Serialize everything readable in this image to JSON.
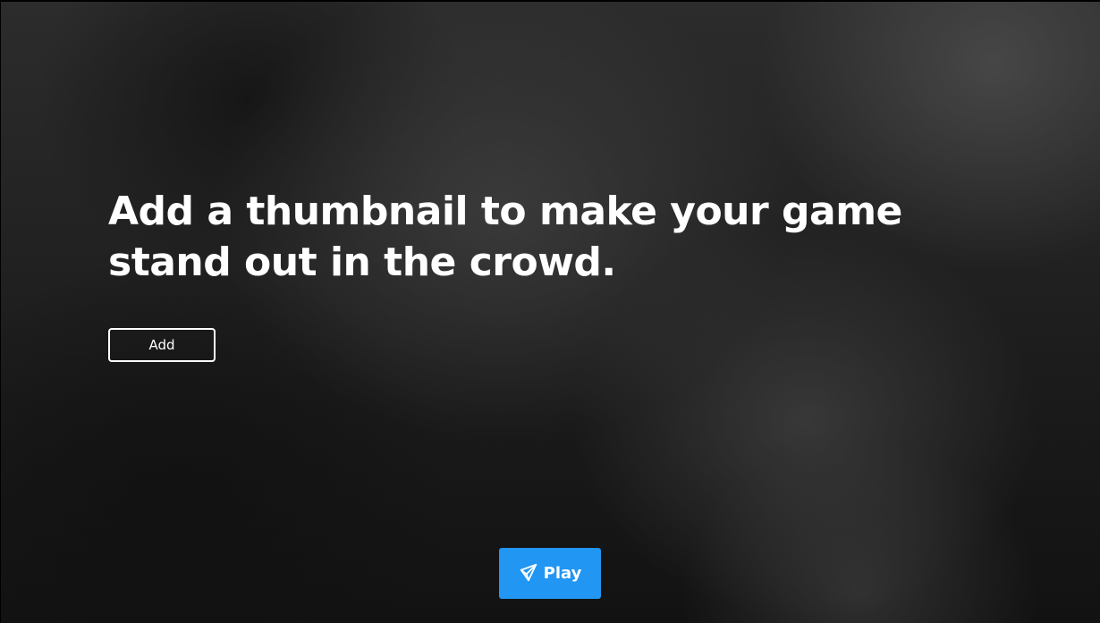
{
  "hero": {
    "headline": "Add a thumbnail to make your game stand out in the crowd."
  },
  "actions": {
    "add_label": "Add",
    "play_label": "Play",
    "play_icon": "unity-logo-icon",
    "play_color": "#2196f3"
  }
}
